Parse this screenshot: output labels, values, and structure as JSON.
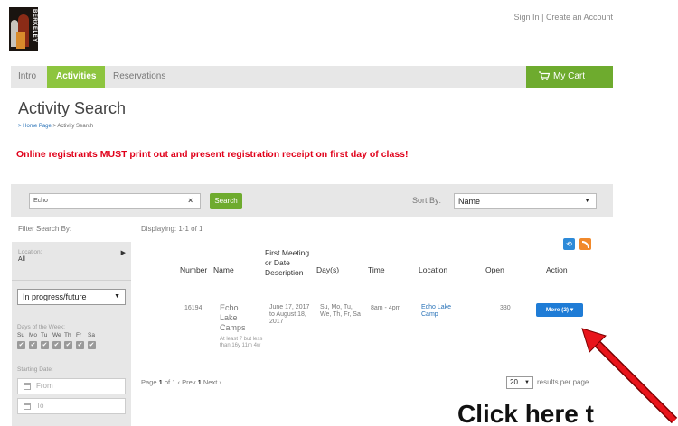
{
  "logo": {
    "text": "BERKELEY"
  },
  "top_links": {
    "sign_in": "Sign In",
    "separator": "|",
    "create_account": "Create an Account"
  },
  "nav": {
    "tabs": [
      {
        "label": "Intro"
      },
      {
        "label": "Activities",
        "active": true
      },
      {
        "label": "Reservations"
      }
    ],
    "cart_label": "My Cart"
  },
  "page": {
    "title": "Activity Search",
    "breadcrumb": {
      "home": "> Home Page",
      "current": "> Activity Search"
    },
    "notice": "Online registrants MUST print out and present registration receipt on first day of class!"
  },
  "search": {
    "value": "Echo",
    "clear_symbol": "×",
    "button_label": "Search",
    "sort_label": "Sort By:",
    "sort_value": "Name"
  },
  "filters": {
    "title": "Filter Search By:",
    "location_label": "Location:",
    "location_value": "All",
    "status_value": "In progress/future",
    "days_label": "Days of the Week:",
    "days": [
      "Su",
      "Mo",
      "Tu",
      "We",
      "Th",
      "Fr",
      "Sa"
    ],
    "starting_date_label": "Starting Date:",
    "from_placeholder": "From",
    "to_placeholder": "To"
  },
  "results": {
    "displaying": "Displaying: 1-1 of 1",
    "headers": {
      "number": "Number",
      "name": "Name",
      "first_meeting": "First Meeting or Date Description",
      "days": "Day(s)",
      "time": "Time",
      "location": "Location",
      "open": "Open",
      "action": "Action"
    },
    "rows": [
      {
        "number": "16194",
        "name": "Echo Lake Camps",
        "note": "At least 7 but less than 16y 11m 4w",
        "first_meeting": "June 17, 2017 to August 18, 2017",
        "days": "Su, Mo, Tu, We, Th, Fr, Sa",
        "time": "8am - 4pm",
        "location": "Echo Lake Camp",
        "open": "330",
        "action_label": "More (2) ▾"
      }
    ],
    "pager": {
      "prefix": "Page",
      "current": "1",
      "of": "of 1 ‹ Prev",
      "page_link": "1",
      "next": "Next ›"
    },
    "per_page_value": "20",
    "per_page_label": "results per page"
  },
  "annotation": {
    "callout_text": "Click here t",
    "arrow_color": "#e8151b"
  },
  "colors": {
    "accent_green": "#8dc53f",
    "cart_green": "#6eab2e",
    "notice_red": "#e0001a",
    "more_blue": "#1f7cd6"
  }
}
